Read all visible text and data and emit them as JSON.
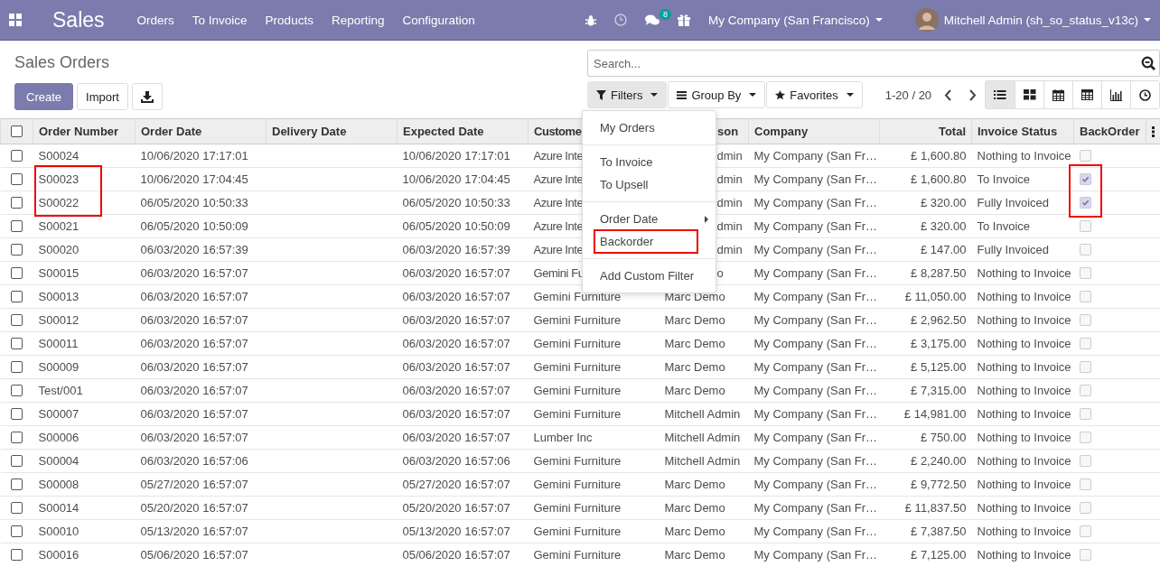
{
  "navbar": {
    "app": "Sales",
    "menu": [
      "Orders",
      "To Invoice",
      "Products",
      "Reporting",
      "Configuration"
    ],
    "messages_badge": "8",
    "company": "My Company (San Francisco)",
    "user": "Mitchell Admin (sh_so_status_v13c)"
  },
  "page": {
    "title": "Sales Orders",
    "buttons": [
      "Create",
      "Import"
    ]
  },
  "search": {
    "placeholder": "Search..."
  },
  "search_buttons": [
    {
      "label": "Filters",
      "selected": true
    },
    {
      "label": "Group By",
      "selected": false
    },
    {
      "label": "Favorites",
      "selected": false
    }
  ],
  "pager": "1-20 / 20",
  "views": [
    {
      "selected": true
    },
    {
      "selected": false
    },
    {
      "selected": false
    },
    {
      "selected": false
    },
    {
      "selected": false
    },
    {
      "selected": false
    }
  ],
  "filters_menu": {
    "groups": [
      [
        {
          "label": "My Orders",
          "kind": "item",
          "marked": false
        }
      ],
      [
        {
          "label": "To Invoice",
          "kind": "item",
          "marked": false
        },
        {
          "label": "To Upsell",
          "kind": "item",
          "marked": false
        }
      ],
      [
        {
          "label": "Order Date",
          "kind": "submenu",
          "marked": false
        },
        {
          "label": "Backorder",
          "kind": "item",
          "marked": true
        }
      ],
      [
        {
          "label": "Add Custom Filter",
          "kind": "item",
          "marked": false
        }
      ]
    ]
  },
  "table": {
    "select_all_checked": false,
    "columns": [
      "Order Number",
      "Order Date",
      "Delivery Date",
      "Expected Date",
      "Custome",
      "son",
      "Company",
      "Total",
      "Invoice Status",
      "BackOrder"
    ],
    "rows": [
      {
        "checked": false,
        "cells": [
          "S00024",
          "10/06/2020 17:17:01",
          "",
          "10/06/2020 17:17:01",
          "Azure Inte",
          "dmin",
          "My Company (San Fr…",
          "£ 1,600.80",
          "Nothing to Invoice"
        ],
        "backorder": false,
        "marked": false
      },
      {
        "checked": false,
        "cells": [
          "S00023",
          "10/06/2020 17:04:45",
          "",
          "10/06/2020 17:04:45",
          "Azure Inte",
          "dmin",
          "My Company (San Fr…",
          "£ 1,600.80",
          "To Invoice"
        ],
        "backorder": true,
        "marked": true
      },
      {
        "checked": false,
        "cells": [
          "S00022",
          "06/05/2020 10:50:33",
          "",
          "06/05/2020 10:50:33",
          "Azure Inte",
          "dmin",
          "My Company (San Fr…",
          "£ 320.00",
          "Fully Invoiced"
        ],
        "backorder": true,
        "marked": true
      },
      {
        "checked": false,
        "cells": [
          "S00021",
          "06/05/2020 10:50:09",
          "",
          "06/05/2020 10:50:09",
          "Azure Inte",
          "dmin",
          "My Company (San Fr…",
          "£ 320.00",
          "To Invoice"
        ],
        "backorder": false,
        "marked": false
      },
      {
        "checked": false,
        "cells": [
          "S00020",
          "06/03/2020 16:57:39",
          "",
          "06/03/2020 16:57:39",
          "Azure Inte",
          "dmin",
          "My Company (San Fr…",
          "£ 147.00",
          "Fully Invoiced"
        ],
        "backorder": false,
        "marked": false
      },
      {
        "checked": false,
        "cells": [
          "S00015",
          "06/03/2020 16:57:07",
          "",
          "06/03/2020 16:57:07",
          "Gemini Fu",
          "o",
          "My Company (San Fr…",
          "£ 8,287.50",
          "Nothing to Invoice"
        ],
        "backorder": false,
        "marked": false
      },
      {
        "checked": false,
        "cells": [
          "S00013",
          "06/03/2020 16:57:07",
          "",
          "06/03/2020 16:57:07",
          "Gemini Furniture",
          "Marc Demo",
          "My Company (San Fr…",
          "£ 11,050.00",
          "Nothing to Invoice"
        ],
        "backorder": false,
        "marked": false
      },
      {
        "checked": false,
        "cells": [
          "S00012",
          "06/03/2020 16:57:07",
          "",
          "06/03/2020 16:57:07",
          "Gemini Furniture",
          "Marc Demo",
          "My Company (San Fr…",
          "£ 2,962.50",
          "Nothing to Invoice"
        ],
        "backorder": false,
        "marked": false
      },
      {
        "checked": false,
        "cells": [
          "S00011",
          "06/03/2020 16:57:07",
          "",
          "06/03/2020 16:57:07",
          "Gemini Furniture",
          "Marc Demo",
          "My Company (San Fr…",
          "£ 3,175.00",
          "Nothing to Invoice"
        ],
        "backorder": false,
        "marked": false
      },
      {
        "checked": false,
        "cells": [
          "S00009",
          "06/03/2020 16:57:07",
          "",
          "06/03/2020 16:57:07",
          "Gemini Furniture",
          "Marc Demo",
          "My Company (San Fr…",
          "£ 5,125.00",
          "Nothing to Invoice"
        ],
        "backorder": false,
        "marked": false
      },
      {
        "checked": false,
        "cells": [
          "Test/001",
          "06/03/2020 16:57:07",
          "",
          "06/03/2020 16:57:07",
          "Gemini Furniture",
          "Marc Demo",
          "My Company (San Fr…",
          "£ 7,315.00",
          "Nothing to Invoice"
        ],
        "backorder": false,
        "marked": false
      },
      {
        "checked": false,
        "cells": [
          "S00007",
          "06/03/2020 16:57:07",
          "",
          "06/03/2020 16:57:07",
          "Gemini Furniture",
          "Mitchell Admin",
          "My Company (San Fr…",
          "£ 14,981.00",
          "Nothing to Invoice"
        ],
        "backorder": false,
        "marked": false
      },
      {
        "checked": false,
        "cells": [
          "S00006",
          "06/03/2020 16:57:07",
          "",
          "06/03/2020 16:57:07",
          "Lumber Inc",
          "Mitchell Admin",
          "My Company (San Fr…",
          "£ 750.00",
          "Nothing to Invoice"
        ],
        "backorder": false,
        "marked": false
      },
      {
        "checked": false,
        "cells": [
          "S00004",
          "06/03/2020 16:57:06",
          "",
          "06/03/2020 16:57:06",
          "Gemini Furniture",
          "Mitchell Admin",
          "My Company (San Fr…",
          "£ 2,240.00",
          "Nothing to Invoice"
        ],
        "backorder": false,
        "marked": false
      },
      {
        "checked": false,
        "cells": [
          "S00008",
          "05/27/2020 16:57:07",
          "",
          "05/27/2020 16:57:07",
          "Gemini Furniture",
          "Marc Demo",
          "My Company (San Fr…",
          "£ 9,772.50",
          "Nothing to Invoice"
        ],
        "backorder": false,
        "marked": false
      },
      {
        "checked": false,
        "cells": [
          "S00014",
          "05/20/2020 16:57:07",
          "",
          "05/20/2020 16:57:07",
          "Gemini Furniture",
          "Marc Demo",
          "My Company (San Fr…",
          "£ 11,837.50",
          "Nothing to Invoice"
        ],
        "backorder": false,
        "marked": false
      },
      {
        "checked": false,
        "cells": [
          "S00010",
          "05/13/2020 16:57:07",
          "",
          "05/13/2020 16:57:07",
          "Gemini Furniture",
          "Marc Demo",
          "My Company (San Fr…",
          "£ 7,387.50",
          "Nothing to Invoice"
        ],
        "backorder": false,
        "marked": false
      },
      {
        "checked": false,
        "cells": [
          "S00016",
          "05/06/2020 16:57:07",
          "",
          "05/06/2020 16:57:07",
          "Gemini Furniture",
          "Marc Demo",
          "My Company (San Fr…",
          "£ 7,125.00",
          "Nothing to Invoice"
        ],
        "backorder": false,
        "marked": false
      }
    ]
  }
}
